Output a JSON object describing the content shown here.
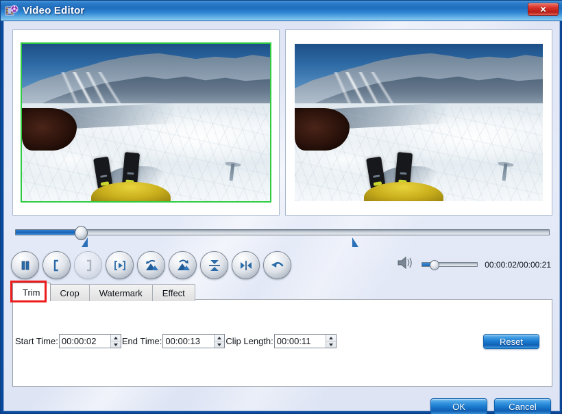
{
  "window": {
    "title": "Video Editor",
    "icon": "video-film-icon",
    "close_label": "✕"
  },
  "preview": {
    "left_pane_name": "source-preview",
    "right_pane_name": "output-preview",
    "left_selected_border_color": "#2ecc40",
    "scene_description": "skiing POV snow mountain"
  },
  "timeline": {
    "position_percent": 12.4,
    "start_marker_percent": 14,
    "end_marker_percent": 63
  },
  "toolbar": {
    "buttons": [
      {
        "name": "pause-button",
        "icon": "pause-icon",
        "disabled": false
      },
      {
        "name": "set-start-button",
        "icon": "bracket-left-icon",
        "disabled": false
      },
      {
        "name": "set-end-button",
        "icon": "bracket-right-icon",
        "disabled": true
      },
      {
        "name": "play-segment-button",
        "icon": "play-bracket-icon",
        "disabled": false
      },
      {
        "name": "rotate-left-button",
        "icon": "rotate-left-icon",
        "disabled": false
      },
      {
        "name": "rotate-right-button",
        "icon": "rotate-right-icon",
        "disabled": false
      },
      {
        "name": "flip-vertical-button",
        "icon": "flip-vertical-icon",
        "disabled": false
      },
      {
        "name": "flip-horizontal-button",
        "icon": "flip-horizontal-icon",
        "disabled": false
      },
      {
        "name": "undo-button",
        "icon": "undo-arrow-icon",
        "disabled": false
      }
    ]
  },
  "volume": {
    "icon": "speaker-icon",
    "level_percent": 22
  },
  "playback": {
    "time_display": "00:00:02/00:00:21",
    "current_time": "00:00:02",
    "total_time": "00:00:21"
  },
  "tabs": {
    "items": [
      {
        "label": "Trim",
        "name": "tab-trim",
        "active": true
      },
      {
        "label": "Crop",
        "name": "tab-crop",
        "active": false
      },
      {
        "label": "Watermark",
        "name": "tab-watermark",
        "active": false
      },
      {
        "label": "Effect",
        "name": "tab-effect",
        "active": false
      }
    ],
    "highlight_color": "#ee1b1b",
    "highlighted_tab": "Trim"
  },
  "trim_panel": {
    "start_time_label": "Start Time:",
    "start_time_value": "00:00:02",
    "end_time_label": "End Time:",
    "end_time_value": "00:00:13",
    "clip_length_label": "Clip Length:",
    "clip_length_value": "00:00:11",
    "reset_label": "Reset"
  },
  "footer": {
    "ok_label": "OK",
    "cancel_label": "Cancel"
  },
  "colors": {
    "title_bar": "#2d7cc9",
    "accent_blue": "#1877cc",
    "panel_bg": "#e6ebf8",
    "annotation_red": "#ee1b1b"
  }
}
